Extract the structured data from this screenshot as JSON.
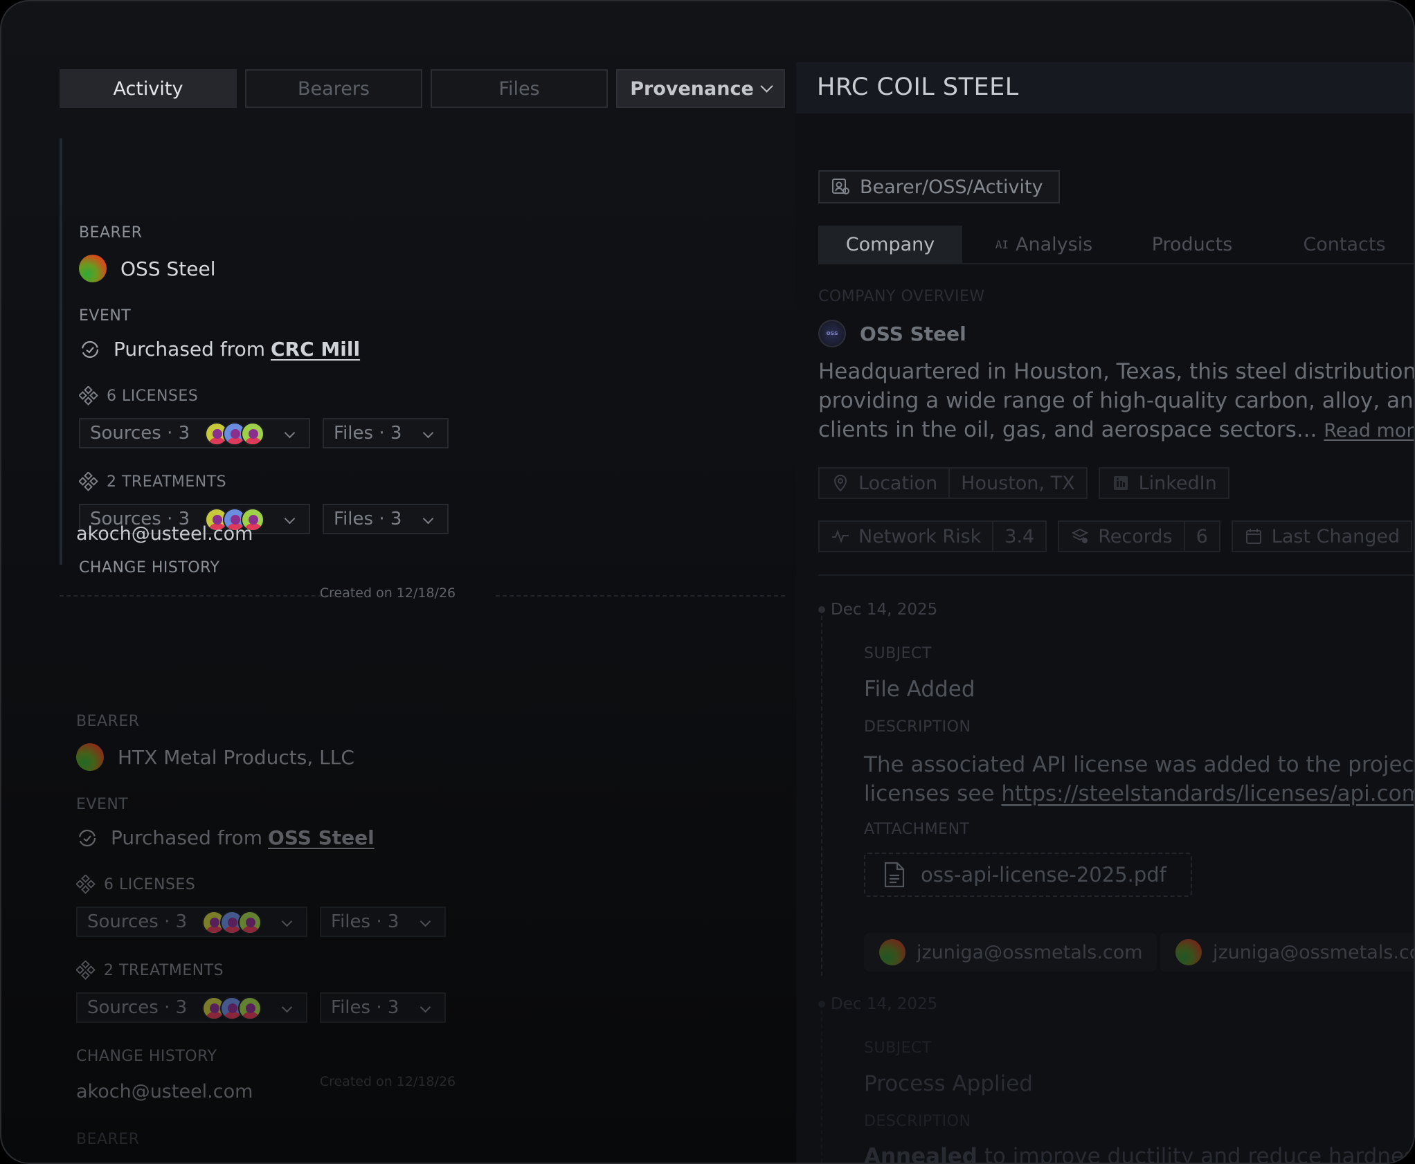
{
  "left": {
    "tabs": [
      {
        "label": "Activity"
      },
      {
        "label": "Bearers"
      },
      {
        "label": "Files"
      },
      {
        "label": "Provenance"
      }
    ],
    "cards": [
      {
        "bearer_label": "BEARER",
        "bearer_name": "OSS Steel",
        "event_label": "EVENT",
        "event_prefix": "Purchased from",
        "event_link": "CRC Mill",
        "licenses_label": "6 LICENSES",
        "treatments_label": "2 TREATMENTS",
        "sources_label": "Sources · 3",
        "files_label": "Files · 3",
        "history_label": "CHANGE HISTORY",
        "history_email": "akoch@usteel.com",
        "created": "Created on 12/18/26"
      },
      {
        "bearer_label": "BEARER",
        "bearer_name": "HTX Metal Products, LLC",
        "event_label": "EVENT",
        "event_prefix": "Purchased from",
        "event_link": "OSS Steel",
        "licenses_label": "6 LICENSES",
        "treatments_label": "2 TREATMENTS",
        "sources_label": "Sources · 3",
        "files_label": "Files · 3",
        "history_label": "CHANGE HISTORY",
        "history_email": "akoch@usteel.com",
        "created": "Created on 12/18/26"
      },
      {
        "bearer_label": "BEARER"
      }
    ]
  },
  "right": {
    "title": "HRC COIL STEEL",
    "breadcrumb": "Bearer/OSS/Activity",
    "tabs": [
      {
        "label": "Company"
      },
      {
        "prefix": "AI",
        "label": "Analysis"
      },
      {
        "label": "Products"
      },
      {
        "label": "Contacts"
      }
    ],
    "section_title": "COMPANY OVERVIEW",
    "company_name": "OSS Steel",
    "company_logo_text": "oss",
    "description_lines": [
      "Headquartered in Houston, Texas, this steel distribution com",
      "providing a wide range of high-quality carbon, alloy, and sta",
      "clients in the oil, gas, and aerospace sectors..."
    ],
    "read_more": "Read more",
    "location_label": "Location",
    "location_value": "Houston, TX",
    "linkedin_label": "LinkedIn",
    "network_risk_label": "Network Risk",
    "network_risk_value": "3.4",
    "records_label": "Records",
    "records_value": "6",
    "last_changed_label": "Last Changed",
    "timeline": [
      {
        "date": "Dec 14, 2025",
        "subject_label": "SUBJECT",
        "subject": "File Added",
        "description_label": "DESCRIPTION",
        "description_line1": "The associated API license was added to the project. Fo",
        "description_line2_prefix": "licenses see",
        "description_link": "https://steelstandards/licenses/api.com.",
        "attachment_label": "ATTACHMENT",
        "attachment": "oss-api-license-2025.pdf",
        "contacts": [
          "jzuniga@ossmetals.com",
          "jzuniga@ossmetals.com"
        ]
      },
      {
        "date": "Dec 14, 2025",
        "subject_label": "SUBJECT",
        "subject": "Process Applied",
        "description_label": "DESCRIPTION",
        "description_bold": "Annealed",
        "description_rest": "to improve ductility and reduce hardness (s"
      }
    ]
  },
  "colors": {
    "background": "#0d0e11",
    "panel_header": "#161a20",
    "active_tab": "#25272c",
    "text_primary": "#e4e6ea"
  }
}
